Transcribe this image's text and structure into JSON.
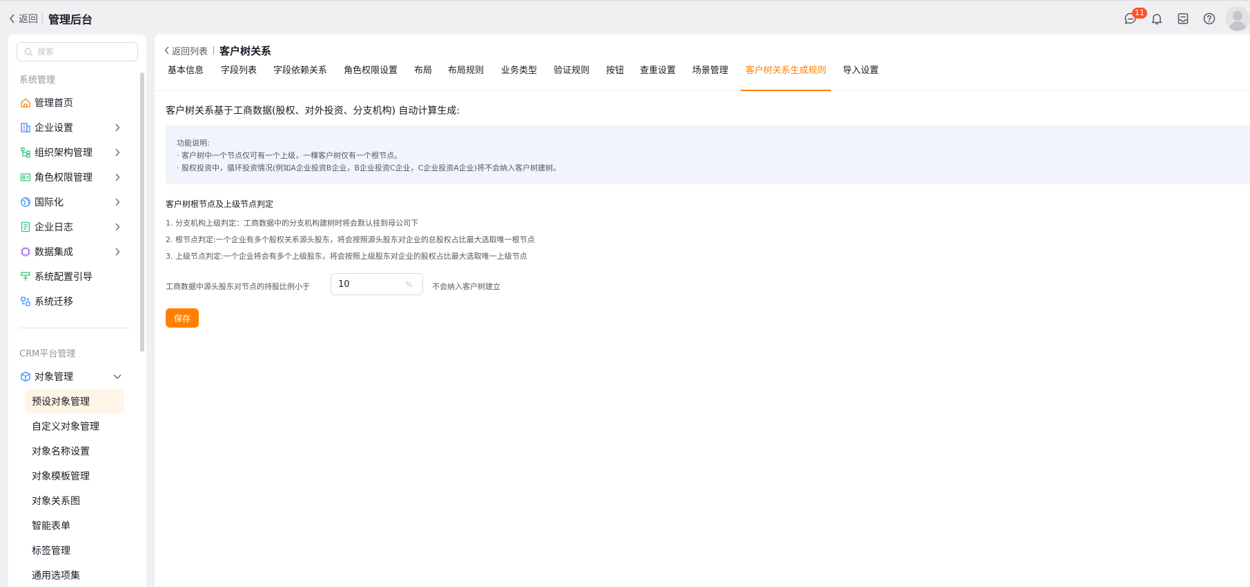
{
  "topbar": {
    "back_label": "返回",
    "app_title": "管理后台",
    "message_badge": "11"
  },
  "sidebar": {
    "search_placeholder": "搜索",
    "section_system": "系统管理",
    "system_items": [
      {
        "label": "管理首页",
        "icon": "home-icon",
        "expandable": false
      },
      {
        "label": "企业设置",
        "icon": "enterprise-icon",
        "expandable": true
      },
      {
        "label": "组织架构管理",
        "icon": "org-icon",
        "expandable": true
      },
      {
        "label": "角色权限管理",
        "icon": "role-icon",
        "expandable": true
      },
      {
        "label": "国际化",
        "icon": "globe-icon",
        "expandable": true
      },
      {
        "label": "企业日志",
        "icon": "log-icon",
        "expandable": true
      },
      {
        "label": "数据集成",
        "icon": "chip-icon",
        "expandable": true
      },
      {
        "label": "系统配置引导",
        "icon": "guide-icon",
        "expandable": false
      },
      {
        "label": "系统迁移",
        "icon": "migrate-icon",
        "expandable": false
      }
    ],
    "section_crm": "CRM平台管理",
    "object_mgmt": {
      "label": "对象管理",
      "icon": "object-icon",
      "expanded": true
    },
    "object_sub_items": [
      {
        "label": "预设对象管理",
        "active": true
      },
      {
        "label": "自定义对象管理",
        "active": false
      },
      {
        "label": "对象名称设置",
        "active": false
      },
      {
        "label": "对象模板管理",
        "active": false
      },
      {
        "label": "对象关系图",
        "active": false
      },
      {
        "label": "智能表单",
        "active": false
      },
      {
        "label": "标签管理",
        "active": false
      },
      {
        "label": "通用选项集",
        "active": false
      }
    ]
  },
  "main": {
    "breadcrumb_back": "返回列表",
    "breadcrumb_title": "客户树关系",
    "tabs": [
      {
        "label": "基本信息",
        "active": false
      },
      {
        "label": "字段列表",
        "active": false
      },
      {
        "label": "字段依赖关系",
        "active": false
      },
      {
        "label": "角色权限设置",
        "active": false
      },
      {
        "label": "布局",
        "active": false
      },
      {
        "label": "布局规则",
        "active": false
      },
      {
        "label": "业务类型",
        "active": false
      },
      {
        "label": "验证规则",
        "active": false
      },
      {
        "label": "按钮",
        "active": false
      },
      {
        "label": "查重设置",
        "active": false
      },
      {
        "label": "场景管理",
        "active": false
      },
      {
        "label": "客户树关系生成规则",
        "active": true
      },
      {
        "label": "导入设置",
        "active": false
      }
    ],
    "headline": "客户树关系基于工商数据(股权、对外投资、分支机构) 自动计算生成:",
    "info": {
      "title": "功能说明:",
      "lines": [
        "· 客户树中一个节点仅可有一个上级，一棵客户树仅有一个根节点。",
        "· 股权投资中，循环投资情况(例如A企业投资B企业，B企业投资C企业，C企业投资A企业)将不会纳入客户树建树。"
      ]
    },
    "rules_heading": "客户树根节点及上级节点判定",
    "rules": [
      "1. 分支机构上级判定：工商数据中的分支机构建树时将会默认挂到母公司下",
      "2. 根节点判定:一个企业有多个股权关系源头股东，将会按照源头股东对企业的总股权占比最大选取唯一根节点",
      "3. 上级节点判定:一个企业将会有多个上级股东，将会按照上级股东对企业的股权占比最大选取唯一上级节点"
    ],
    "threshold": {
      "label": "工商数据中源头股东对节点的持股比例小于",
      "value": "10",
      "unit": "%",
      "suffix": "不会纳入客户树建立"
    },
    "save_label": "保存"
  },
  "colors": {
    "accent": "#ff8000",
    "badge": "#ff522a",
    "info_bg": "#f2f4fb",
    "active_item_bg": "#fff5e6"
  }
}
